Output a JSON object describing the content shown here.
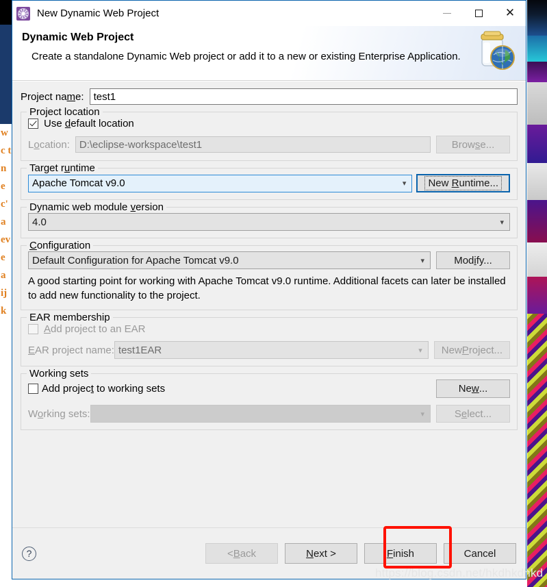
{
  "window": {
    "title": "New Dynamic Web Project",
    "icon": "eclipse-project-icon",
    "minimize_label": "–",
    "maximize_label": "□",
    "close_label": "✕"
  },
  "header": {
    "title": "Dynamic Web Project",
    "description": "Create a standalone Dynamic Web project or add it to a new or existing Enterprise Application.",
    "banner_icon": "jar-globe-icon"
  },
  "project_name": {
    "label": "Project name:",
    "label_pre": "Project na",
    "label_mnemonic": "m",
    "label_post": "e:",
    "value": "test1",
    "placeholder": ""
  },
  "project_location": {
    "group_title": "Project location",
    "use_default": {
      "label_pre": "Use ",
      "label_mnemonic": "d",
      "label_post": "efault location",
      "checked": true
    },
    "location": {
      "label_pre": "L",
      "label_mnemonic": "o",
      "label_post": "cation:",
      "value": "D:\\eclipse-workspace\\test1",
      "enabled": false
    },
    "browse_button": {
      "label_pre": "Brow",
      "label_mnemonic": "s",
      "label_post": "e...",
      "enabled": false
    }
  },
  "target_runtime": {
    "group_title_pre": "Target r",
    "group_title_mnemonic": "u",
    "group_title_post": "ntime",
    "value": "Apache Tomcat v9.0",
    "focused": true,
    "new_runtime_button": {
      "label_pre": "New ",
      "label_mnemonic": "R",
      "label_post": "untime...",
      "focused": true
    }
  },
  "module_version": {
    "group_title_pre": "Dynamic web module ",
    "group_title_mnemonic": "v",
    "group_title_post": "ersion",
    "value": "4.0"
  },
  "configuration": {
    "group_title_pre": "",
    "group_title_mnemonic": "C",
    "group_title_post": "onfiguration",
    "value": "Default Configuration for Apache Tomcat v9.0",
    "modify_button": {
      "label_pre": "Mod",
      "label_mnemonic": "i",
      "label_post": "fy..."
    },
    "description": "A good starting point for working with Apache Tomcat v9.0 runtime. Additional facets can later be installed to add new functionality to the project."
  },
  "ear_membership": {
    "group_title": "EAR membership",
    "add_to_ear": {
      "label_pre": "",
      "label_mnemonic": "A",
      "label_post": "dd project to an EAR",
      "checked": false,
      "enabled": false
    },
    "ear_project_name": {
      "label_pre": "",
      "label_mnemonic": "E",
      "label_post": "AR project name:",
      "value": "test1EAR",
      "enabled": false
    },
    "new_project_button": {
      "label_pre": "New ",
      "label_mnemonic": "P",
      "label_post": "roject...",
      "enabled": false
    }
  },
  "working_sets": {
    "group_title": "Working sets",
    "add_to_working_sets": {
      "label_pre": "Add projec",
      "label_mnemonic": "t",
      "label_post": " to working sets",
      "checked": false
    },
    "new_button": {
      "label_pre": "Ne",
      "label_mnemonic": "w",
      "label_post": "..."
    },
    "working_sets_field": {
      "label_pre": "W",
      "label_mnemonic": "o",
      "label_post": "rking sets:",
      "value": "",
      "enabled": false
    },
    "select_button": {
      "label_pre": "S",
      "label_mnemonic": "e",
      "label_post": "lect...",
      "enabled": false
    }
  },
  "footer": {
    "help_icon": "question-mark-icon",
    "back_button": {
      "label_pre": "< ",
      "label_mnemonic": "B",
      "label_post": "ack",
      "enabled": false
    },
    "next_button": {
      "label_pre": "",
      "label_mnemonic": "N",
      "label_post": "ext >",
      "enabled": true
    },
    "finish_button": {
      "label_pre": "",
      "label_mnemonic": "F",
      "label_post": "inish",
      "enabled": true,
      "highlighted": true
    },
    "cancel_button": {
      "label": "Cancel",
      "enabled": true
    }
  },
  "watermark": "https://blog.csdn.net/hkdhkdhkd",
  "background_left_text": "w c t n e c' a ev e a ij k",
  "colors": {
    "dialog_border": "#0a64ad",
    "annotation": "#ff1100",
    "focus_blue": "#2d8ad6",
    "combo_focus_bg": "#e4f1fb",
    "body_bg": "#f0f0f0"
  }
}
